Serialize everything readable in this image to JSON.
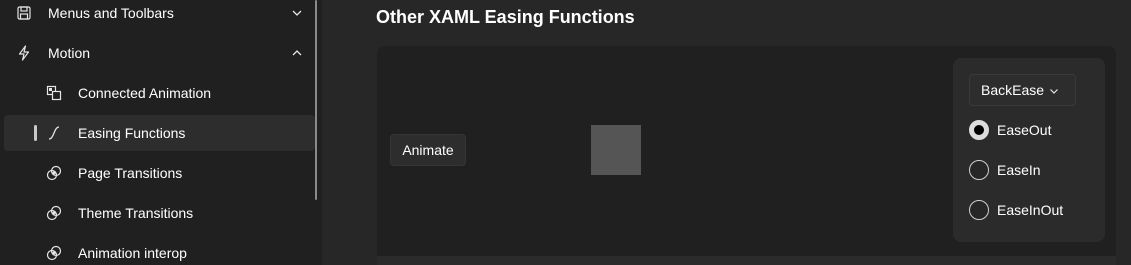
{
  "sidebar": {
    "items": [
      {
        "label": "Menus and Toolbars",
        "icon": "save-icon",
        "chevron": "down"
      },
      {
        "label": "Motion",
        "icon": "lightning-icon",
        "chevron": "up"
      },
      {
        "label": "Connected Animation",
        "icon": "connected-animation-icon"
      },
      {
        "label": "Easing Functions",
        "icon": "easing-curve-icon",
        "selected": true
      },
      {
        "label": "Page Transitions",
        "icon": "transition-icon"
      },
      {
        "label": "Theme Transitions",
        "icon": "transition-icon"
      },
      {
        "label": "Animation interop",
        "icon": "transition-icon"
      }
    ]
  },
  "main": {
    "title": "Other XAML Easing Functions",
    "animate_button": "Animate",
    "combo": {
      "selected": "BackEase"
    },
    "radios": [
      {
        "label": "EaseOut",
        "checked": true
      },
      {
        "label": "EaseIn",
        "checked": false
      },
      {
        "label": "EaseInOut",
        "checked": false
      }
    ]
  },
  "colors": {
    "sidebar_bg": "#202020",
    "main_bg": "#272727",
    "card_bg": "#202020",
    "selected_bg": "#2d2d2d",
    "square": "#555555"
  }
}
